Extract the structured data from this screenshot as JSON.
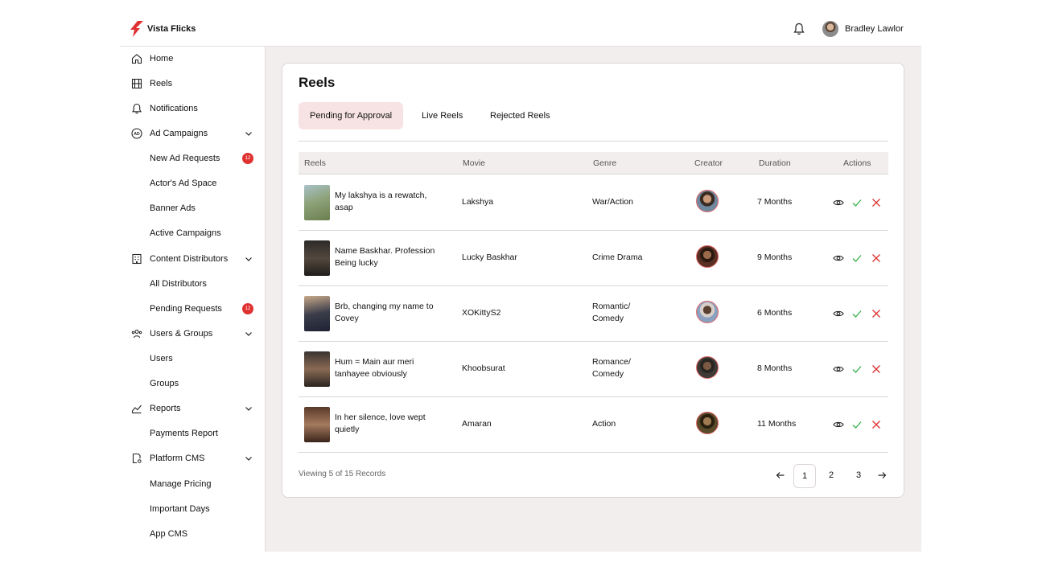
{
  "app": {
    "name": "Vista Flicks"
  },
  "user": {
    "name": "Bradley Lawlor"
  },
  "sidebar": {
    "items": [
      {
        "label": "Home"
      },
      {
        "label": "Reels"
      },
      {
        "label": "Notifications"
      },
      {
        "label": "Ad Campaigns"
      },
      {
        "label": "New Ad Requests",
        "badge": "12"
      },
      {
        "label": "Actor's Ad Space"
      },
      {
        "label": "Banner Ads"
      },
      {
        "label": "Active Campaigns"
      },
      {
        "label": "Content Distributors"
      },
      {
        "label": "All Distributors"
      },
      {
        "label": "Pending Requests",
        "badge": "12"
      },
      {
        "label": "Users & Groups"
      },
      {
        "label": "Users"
      },
      {
        "label": "Groups"
      },
      {
        "label": "Reports"
      },
      {
        "label": "Payments Report"
      },
      {
        "label": "Platform CMS"
      },
      {
        "label": "Manage Pricing"
      },
      {
        "label": "Important Days"
      },
      {
        "label": "App CMS"
      }
    ]
  },
  "page": {
    "title": "Reels",
    "tabs": [
      {
        "label": "Pending for Approval",
        "active": true
      },
      {
        "label": "Live Reels"
      },
      {
        "label": "Rejected Reels"
      }
    ]
  },
  "table": {
    "columns": [
      "Reels",
      "Movie",
      "Genre",
      "Creator",
      "Duration",
      "Actions"
    ],
    "rows": [
      {
        "reel": "My lakshya is a rewatch, asap",
        "movie": "Lakshya",
        "genre": "War/Action",
        "duration": "7 Months"
      },
      {
        "reel": "Name Baskhar. Profession Being lucky",
        "movie": "Lucky Baskhar",
        "genre": "Crime Drama",
        "duration": "9 Months"
      },
      {
        "reel": "Brb, changing my name to Covey",
        "movie": "XOKittyS2",
        "genre": "Romantic/ Comedy",
        "duration": "6 Months"
      },
      {
        "reel": "Hum = Main aur meri tanhayee obviously",
        "movie": "Khoobsurat",
        "genre": "Romance/ Comedy",
        "duration": "8 Months"
      },
      {
        "reel": "In her silence, love wept quietly",
        "movie": "Amaran",
        "genre": "Action",
        "duration": "11 Months"
      }
    ]
  },
  "pagination": {
    "summary": "Viewing 5 of 15 Records",
    "pages": [
      "1",
      "2",
      "3"
    ],
    "current": "1"
  },
  "colors": {
    "accent": "#e03131",
    "tab_active_bg": "#f7e3e3",
    "main_bg": "#f2eeed",
    "approve": "#37b24d",
    "reject": "#e03131"
  }
}
